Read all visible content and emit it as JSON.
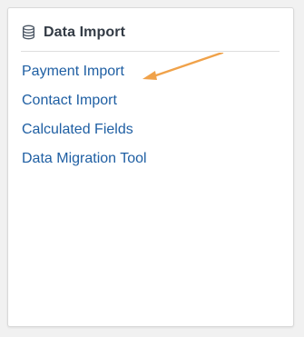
{
  "panel": {
    "title": "Data Import",
    "icon": "database-icon",
    "links": [
      "Payment Import",
      "Contact Import",
      "Calculated Fields",
      "Data Migration Tool"
    ]
  },
  "annotation": {
    "arrow_color": "#f0a24a",
    "target": "Payment Import"
  },
  "colors": {
    "link": "#1f5fa3",
    "title": "#333b45",
    "background": "#f1f1f1"
  }
}
